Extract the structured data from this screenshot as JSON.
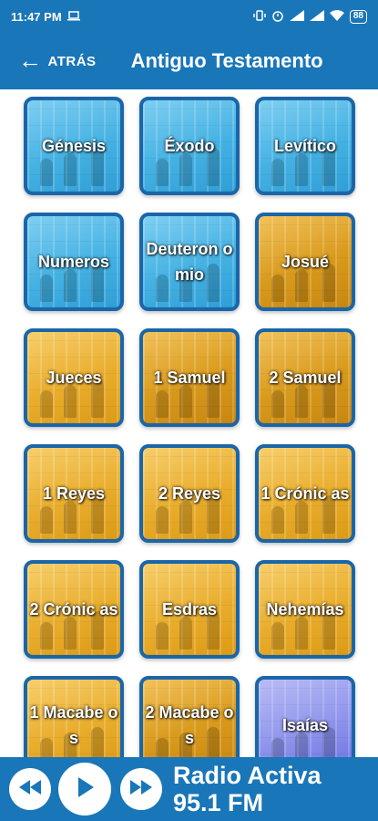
{
  "status_bar": {
    "time": "11:47 PM",
    "battery": "88"
  },
  "app_bar": {
    "back_label": "ATRÁS",
    "title": "Antiguo Testamento"
  },
  "books": [
    {
      "label": "Génesis",
      "style": "blue"
    },
    {
      "label": "Éxodo",
      "style": "blue"
    },
    {
      "label": "Levítico",
      "style": "blue"
    },
    {
      "label": "Numeros",
      "style": "blue"
    },
    {
      "label": "Deuteron omio",
      "style": "blue"
    },
    {
      "label": "Josué",
      "style": "gold2"
    },
    {
      "label": "Jueces",
      "style": "gold"
    },
    {
      "label": "1 Samuel",
      "style": "gold2"
    },
    {
      "label": "2 Samuel",
      "style": "gold2"
    },
    {
      "label": "1 Reyes",
      "style": "gold"
    },
    {
      "label": "2 Reyes",
      "style": "gold"
    },
    {
      "label": "1 Crónic as",
      "style": "gold"
    },
    {
      "label": "2 Crónic as",
      "style": "gold"
    },
    {
      "label": "Esdras",
      "style": "gold"
    },
    {
      "label": "Nehemías",
      "style": "gold"
    },
    {
      "label": "1 Macabe os",
      "style": "gold"
    },
    {
      "label": "2 Macabe os",
      "style": "gold2"
    },
    {
      "label": "Isaías",
      "style": "purple"
    }
  ],
  "player": {
    "station_line1": "Radio Activa",
    "station_line2": "95.1 FM"
  }
}
